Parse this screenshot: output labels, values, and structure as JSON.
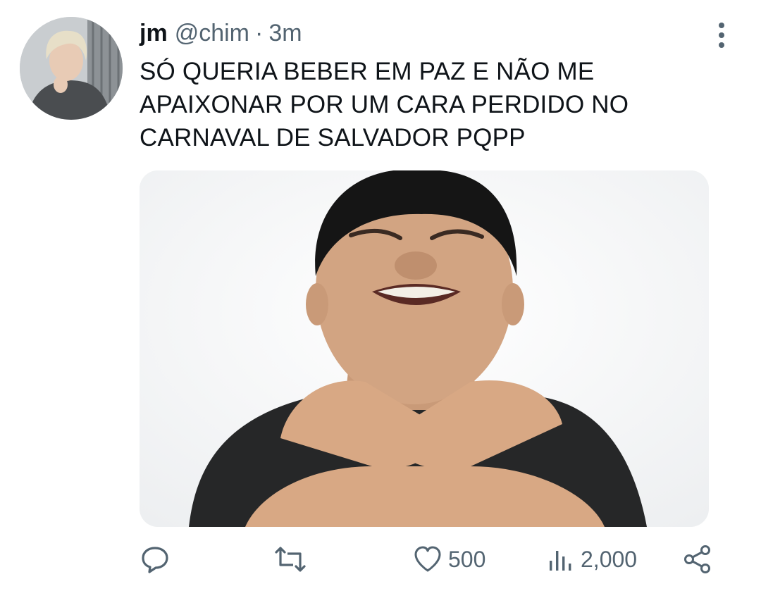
{
  "tweet": {
    "display_name": "jm",
    "handle": "@chim",
    "separator": "·",
    "time": "3m",
    "text_lines": [
      "SÓ QUERIA BEBER EM PAZ E NÃO ME",
      "APAIXONAR POR UM CARA PERDIDO NO",
      "CARNAVAL DE SALVADOR PQPP"
    ]
  },
  "actions": {
    "reply": {
      "icon": "reply-icon"
    },
    "retweet": {
      "icon": "retweet-icon"
    },
    "like": {
      "icon": "heart-icon",
      "count": "500"
    },
    "views": {
      "icon": "views-icon",
      "count": "2,000"
    },
    "share": {
      "icon": "share-icon"
    }
  },
  "colors": {
    "text": "#0f1419",
    "secondary": "#536471",
    "background": "#ffffff"
  }
}
